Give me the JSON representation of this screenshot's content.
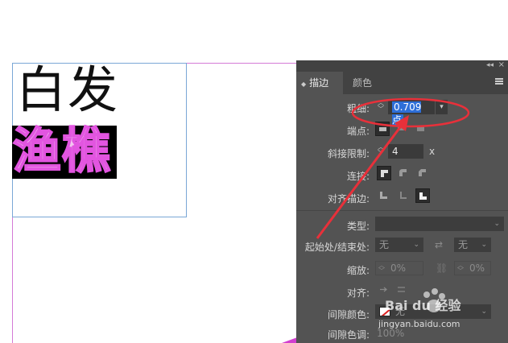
{
  "canvas": {
    "line1": "白发",
    "line2": "渔樵"
  },
  "panel": {
    "tabs": [
      "描边",
      "颜色"
    ],
    "weight": {
      "label": "粗细:",
      "value": "0.709 点"
    },
    "cap": {
      "label": "端点:"
    },
    "miter": {
      "label": "斜接限制:",
      "value": "4",
      "suffix": "x"
    },
    "join": {
      "label": "连接:"
    },
    "align": {
      "label": "对齐描边:"
    },
    "type": {
      "label": "类型:",
      "value": ""
    },
    "start_end": {
      "label": "起始处/结束处:",
      "start": "无",
      "end": "无"
    },
    "scale": {
      "label": "缩放:",
      "start": "0%",
      "end": "0%"
    },
    "align2": {
      "label": "对齐:"
    },
    "gap_color": {
      "label": "间隙颜色:",
      "value": "无"
    },
    "gap_tint": {
      "label": "间隙色调:",
      "value": "100%"
    }
  },
  "watermark": {
    "brand": "Bai du 经验",
    "url": "jingyan.baidu.com"
  },
  "colors": {
    "panel_bg": "#535353",
    "highlight": "#2e6fd8",
    "annotation_red": "#e8303a",
    "text_glow": "#e255e0"
  }
}
